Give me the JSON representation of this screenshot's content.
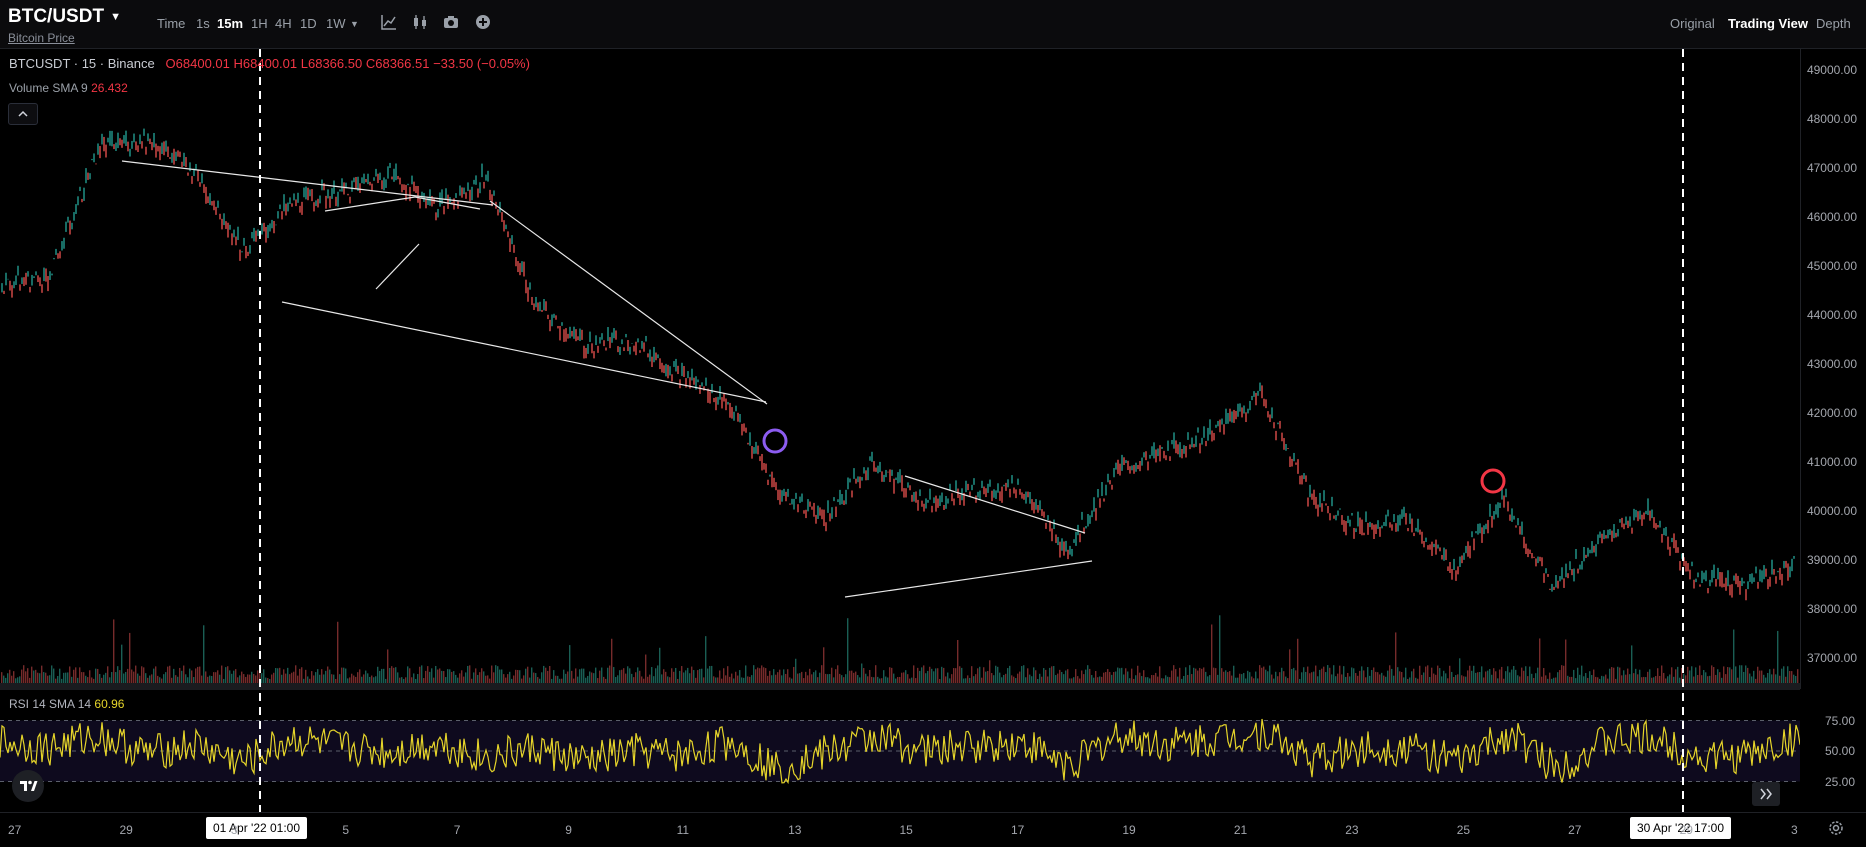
{
  "header": {
    "symbol": "BTC/USDT",
    "subtitle": "Bitcoin Price",
    "timeframes": [
      "Time",
      "1s",
      "15m",
      "1H",
      "4H",
      "1D",
      "1W"
    ],
    "active_timeframe": "15m",
    "tools": [
      "indicators-icon",
      "candle-type-icon",
      "camera-icon",
      "plus-icon"
    ],
    "views": [
      "Original",
      "Trading View",
      "Depth"
    ],
    "active_view": "Trading View"
  },
  "legend": {
    "title": "BTCUSDT · 15 · Binance",
    "open": "O68400.01",
    "high": "H68400.01",
    "low": "L68366.50",
    "close": "C68366.51",
    "change": "−33.50 (−0.05%)",
    "volume_label": "Volume SMA 9",
    "volume_value": "26.432"
  },
  "rsi": {
    "label": "RSI 14 SMA 14",
    "value": "60.96",
    "levels": [
      "75.00",
      "50.00",
      "25.00"
    ]
  },
  "price_axis": [
    "49000.00",
    "48000.00",
    "47000.00",
    "46000.00",
    "45000.00",
    "44000.00",
    "43000.00",
    "42000.00",
    "41000.00",
    "40000.00",
    "39000.00",
    "38000.00",
    "37000.00"
  ],
  "time_axis": {
    "labels": [
      "27",
      "29",
      "3",
      "5",
      "7",
      "9",
      "11",
      "13",
      "15",
      "17",
      "19",
      "21",
      "23",
      "25",
      "27",
      "29",
      "3"
    ],
    "badge_left": "01 Apr '22   01:00",
    "badge_right": "30 Apr '22   17:00"
  },
  "colors": {
    "up": "#26a69a",
    "down": "#ef5350",
    "rsi_line": "#e6d52a",
    "marker_purple": "#8c5cf0",
    "marker_red": "#f23645"
  },
  "chart_data": {
    "type": "line",
    "title": "",
    "series": [
      {
        "name": "BTCUSDT",
        "x": [
          "27",
          "28",
          "29",
          "30",
          "31",
          "1",
          "2",
          "3",
          "4",
          "5",
          "6",
          "7",
          "8",
          "9",
          "10",
          "11",
          "12",
          "13",
          "14",
          "15",
          "16",
          "17",
          "18",
          "19",
          "20",
          "21",
          "22",
          "23",
          "24",
          "25",
          "26",
          "27",
          "28",
          "29",
          "30",
          "1",
          "2",
          "3"
        ],
        "values": [
          44600,
          44800,
          47400,
          47600,
          46900,
          45300,
          46300,
          46500,
          46900,
          46200,
          46800,
          44200,
          43400,
          43500,
          42800,
          42200,
          40400,
          39900,
          41000,
          40200,
          40400,
          40500,
          39200,
          40800,
          41200,
          41600,
          42400,
          40300,
          39700,
          39800,
          38800,
          40300,
          38400,
          39400,
          40000,
          38600,
          38500,
          38900
        ]
      },
      {
        "name": "RSI 14 SMA 14",
        "values": [
          58,
          52,
          63,
          48,
          55,
          40,
          60,
          53,
          49,
          57,
          44,
          52,
          41,
          50,
          46,
          58,
          35,
          49,
          62,
          50,
          54,
          57,
          38,
          63,
          55,
          60,
          66,
          42,
          52,
          53,
          40,
          64,
          36,
          58,
          60,
          44,
          47,
          61
        ]
      }
    ],
    "ylim": [
      36500,
      49300
    ],
    "rsi_ylim": [
      0,
      100
    ],
    "rsi_levels": [
      75,
      50,
      25
    ]
  }
}
